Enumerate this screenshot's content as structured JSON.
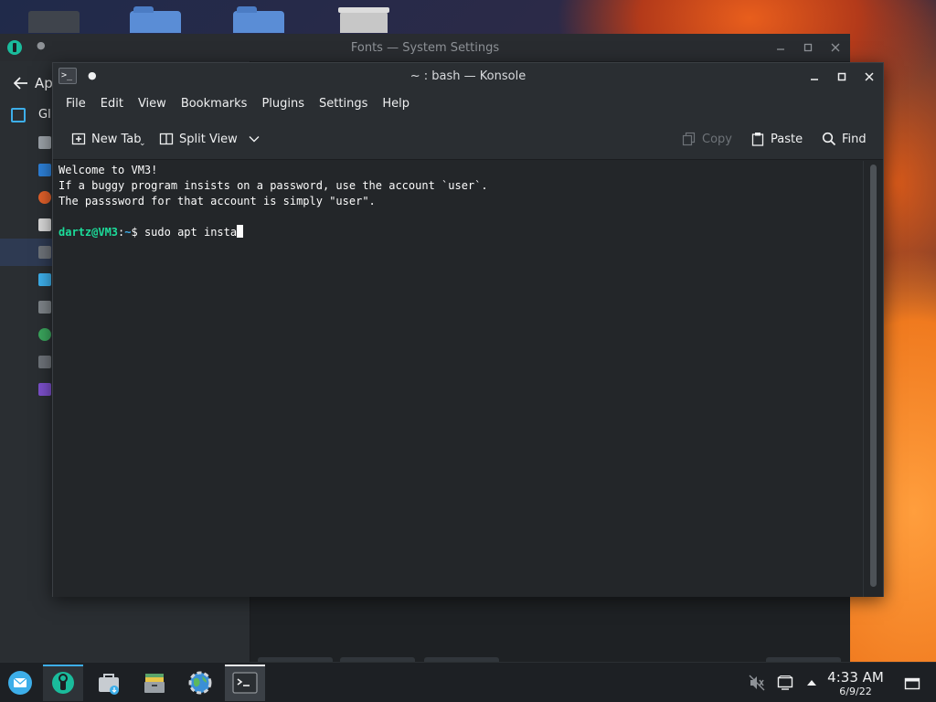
{
  "settings_window": {
    "title": "Fonts — System Settings",
    "sidebar_header_partial": "Ap",
    "sidebar_row_partial": "Gl"
  },
  "konsole": {
    "title": "~ : bash — Konsole",
    "menus": [
      "File",
      "Edit",
      "View",
      "Bookmarks",
      "Plugins",
      "Settings",
      "Help"
    ],
    "toolbar": {
      "new_tab": "New Tab",
      "split_view": "Split View",
      "copy": "Copy",
      "paste": "Paste",
      "find": "Find"
    },
    "terminal": {
      "lines": [
        "Welcome to VM3!",
        "If a buggy program insists on a password, use the account `user`.",
        "The passsword for that account is simply \"user\"."
      ],
      "prompt_user": "dartz@VM3",
      "prompt_sep": ":",
      "prompt_path": "~",
      "prompt_symbol": "$ ",
      "command": "sudo apt insta"
    }
  },
  "taskbar": {
    "clock_time": "4:33 AM",
    "clock_date": "6/9/22"
  },
  "colors": {
    "accent": "#3daee9",
    "prompt_user": "#1cdc9a",
    "terminal_bg": "#232629"
  },
  "icons": {
    "taskbar": [
      "mail-icon",
      "system-settings-icon",
      "discover-store-icon",
      "archive-manager-icon",
      "web-browser-icon",
      "konsole-icon"
    ],
    "tray": [
      "volume-muted-icon",
      "display-icon",
      "tray-expand-icon",
      "show-desktop-icon"
    ]
  }
}
